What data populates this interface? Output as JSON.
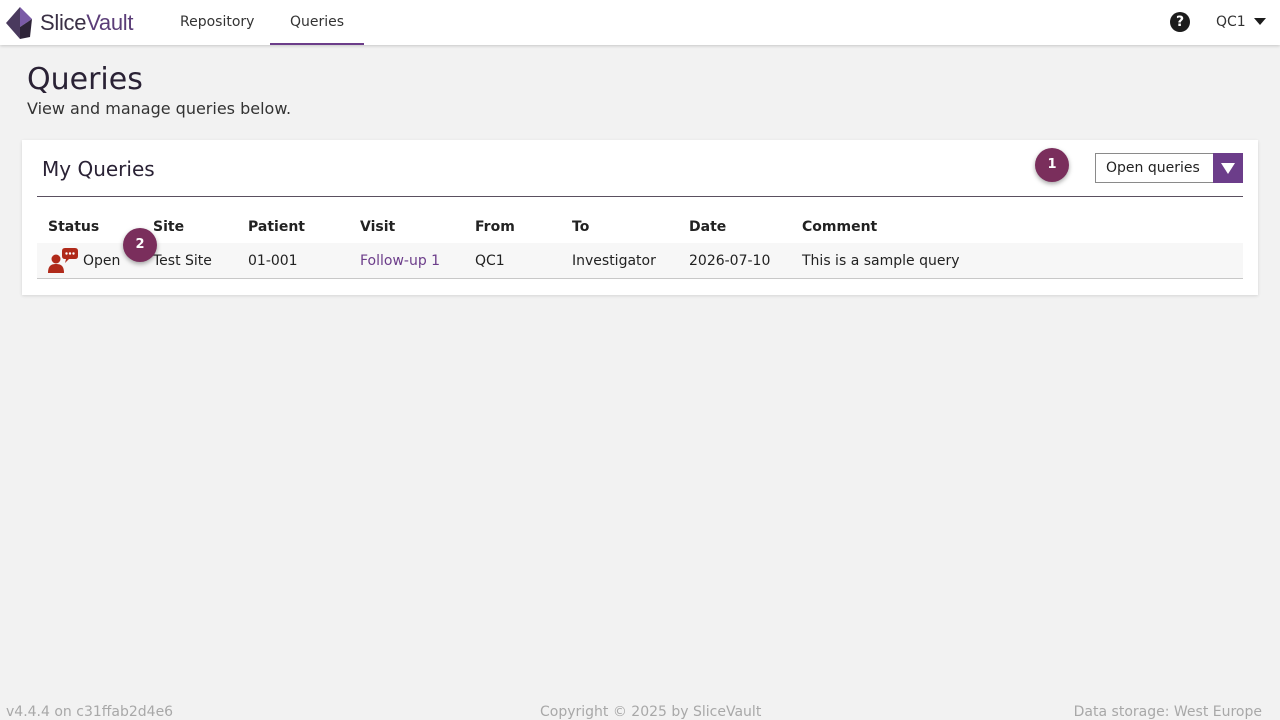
{
  "app": {
    "logo_part1": "Slice",
    "logo_part2": "Vault",
    "accent_color": "#6c3d8a"
  },
  "nav": {
    "items": [
      {
        "label": "Repository"
      },
      {
        "label": "Queries"
      }
    ],
    "active": "Queries",
    "help_icon": "question-circle-icon",
    "user": "QC1"
  },
  "page": {
    "title": "Queries",
    "subtitle": "View and manage queries below."
  },
  "panel": {
    "title": "My Queries",
    "filter_value": "Open queries",
    "columns": [
      "Status",
      "Site",
      "Patient",
      "Visit",
      "From",
      "To",
      "Date",
      "Comment"
    ],
    "rows": [
      {
        "status_icon": "query-conversation-icon",
        "status": "Open",
        "site": "Test Site",
        "patient": "01-001",
        "visit": "Follow-up 1",
        "from": "QC1",
        "to": "Investigator",
        "date": "2026-07-10",
        "comment": "This is a sample query"
      }
    ]
  },
  "badges": [
    "1",
    "2"
  ],
  "footer": {
    "version": "v4.4.4 on c31ffab2d4e6",
    "copyright": "Copyright © 2025 by SliceVault",
    "storage": "Data storage: West Europe"
  }
}
